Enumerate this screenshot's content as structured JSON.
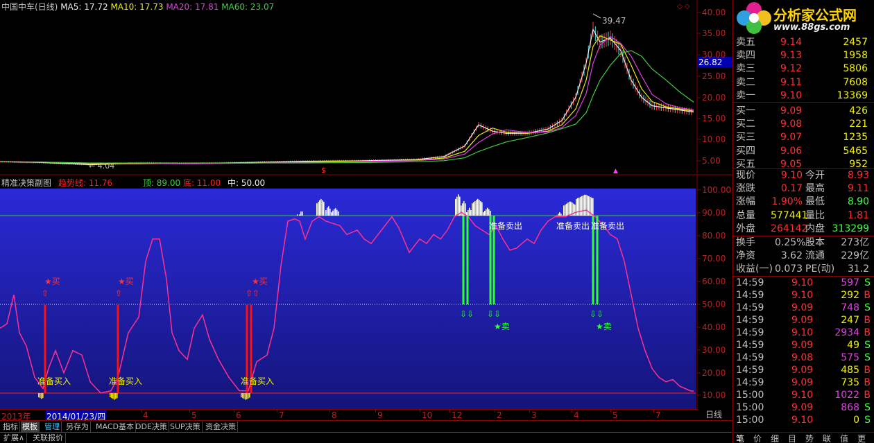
{
  "main_header": {
    "title": "中国中车(日线)",
    "ma5": "MA5: 17.72",
    "ma10": "MA10: 17.73",
    "ma20": "MA20: 17.81",
    "ma60": "MA60: 23.07",
    "corner_icons": "◇ ◇"
  },
  "main_axis": [
    "40.00",
    "35.00",
    "30.00",
    "25.00",
    "20.00",
    "15.00",
    "10.00",
    "5.00"
  ],
  "price_tag": "26.82",
  "peak_label": "39.47",
  "low_label": "← 4.04",
  "sub_header": {
    "title": "精准决策副图",
    "trend": "趋势线: 11.76",
    "top": "顶: 89.00",
    "bottom": "底: 11.00",
    "mid": "中: 50.00"
  },
  "sub_axis": [
    "100.00",
    "90.00",
    "80.00",
    "70.00",
    "60.00",
    "50.00",
    "40.00",
    "30.00",
    "20.00",
    "10.00"
  ],
  "annotations": {
    "buy": "★买",
    "sell": "★卖",
    "ready_buy": "准备买入",
    "ready_sell": "准备卖出"
  },
  "x_axis": {
    "year": "2013年",
    "date": "2014/01/23/四",
    "months": [
      "4",
      "5",
      "6",
      "7",
      "8",
      "9",
      "10",
      "12",
      "2",
      "3",
      "4",
      "5",
      "7"
    ],
    "period": "日线"
  },
  "tabs": [
    "指标",
    "模板",
    "管理",
    "另存为",
    "MACD基本",
    "DDE决策",
    "SUP决策",
    "资金决策"
  ],
  "bottom_tabs": [
    "扩展∧",
    "关联报价"
  ],
  "logo": {
    "name": "分析家公式网",
    "url": "www.88gs.com"
  },
  "order_book": [
    {
      "label": "卖五",
      "price": "9.14",
      "vol": "2457"
    },
    {
      "label": "卖四",
      "price": "9.13",
      "vol": "1958"
    },
    {
      "label": "卖三",
      "price": "9.12",
      "vol": "5806"
    },
    {
      "label": "卖二",
      "price": "9.11",
      "vol": "7608"
    },
    {
      "label": "卖一",
      "price": "9.10",
      "vol": "13369"
    },
    {
      "label": "买一",
      "price": "9.09",
      "vol": "426"
    },
    {
      "label": "买二",
      "price": "9.08",
      "vol": "221"
    },
    {
      "label": "买三",
      "price": "9.07",
      "vol": "1235"
    },
    {
      "label": "买四",
      "price": "9.06",
      "vol": "5465"
    },
    {
      "label": "买五",
      "price": "9.05",
      "vol": "952"
    }
  ],
  "quote_rows": [
    {
      "l1": "现价",
      "v1": "9.10",
      "l2": "今开",
      "v2": "8.93"
    },
    {
      "l1": "涨跌",
      "v1": "0.17",
      "l2": "最高",
      "v2": "9.11"
    },
    {
      "l1": "涨幅",
      "v1": "1.90%",
      "l2": "最低",
      "v2": "8.90"
    },
    {
      "l1": "总量",
      "v1": "577441",
      "l2": "量比",
      "v2": "1.81"
    },
    {
      "l1": "外盘",
      "v1": "264142",
      "l2": "内盘",
      "v2": "313299"
    }
  ],
  "fund_rows": [
    {
      "l1": "换手",
      "v1": "0.25%",
      "l2": "股本",
      "v2": "273亿"
    },
    {
      "l1": "净资",
      "v1": "3.62",
      "l2": "流通",
      "v2": "229亿"
    },
    {
      "l1": "收益(一)",
      "v1": "0.073",
      "l2": "PE(动)",
      "v2": "31.2"
    }
  ],
  "ticks": [
    {
      "time": "14:59",
      "price": "9.10",
      "vol": "597",
      "side": "S"
    },
    {
      "time": "14:59",
      "price": "9.10",
      "vol": "292",
      "side": "B"
    },
    {
      "time": "14:59",
      "price": "9.09",
      "vol": "748",
      "side": "S"
    },
    {
      "time": "14:59",
      "price": "9.09",
      "vol": "247",
      "side": "B"
    },
    {
      "time": "14:59",
      "price": "9.10",
      "vol": "2934",
      "side": "B"
    },
    {
      "time": "14:59",
      "price": "9.09",
      "vol": "49",
      "side": "S"
    },
    {
      "time": "14:59",
      "price": "9.08",
      "vol": "575",
      "side": "S"
    },
    {
      "time": "14:59",
      "price": "9.09",
      "vol": "485",
      "side": "B"
    },
    {
      "time": "14:59",
      "price": "9.09",
      "vol": "735",
      "side": "B"
    },
    {
      "time": "15:00",
      "price": "9.10",
      "vol": "1022",
      "side": "B"
    },
    {
      "time": "15:00",
      "price": "9.09",
      "vol": "868",
      "side": "S"
    },
    {
      "time": "15:00",
      "price": "9.10",
      "vol": "0",
      "side": "S"
    }
  ],
  "right_tabs": [
    "笔",
    "价",
    "细",
    "目",
    "势",
    "联",
    "值",
    "更"
  ]
}
